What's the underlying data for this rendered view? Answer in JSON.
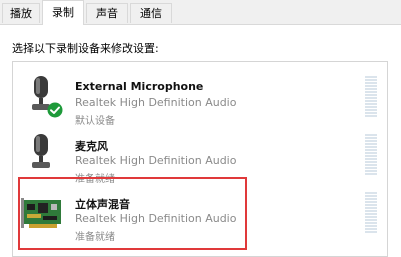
{
  "tabs": [
    {
      "label": "播放"
    },
    {
      "label": "录制"
    },
    {
      "label": "声音"
    },
    {
      "label": "通信"
    }
  ],
  "instruction": "选择以下录制设备来修改设置:",
  "devices": [
    {
      "name": "External Microphone",
      "driver": "Realtek High Definition Audio",
      "status": "默认设备"
    },
    {
      "name": "麦克风",
      "driver": "Realtek High Definition Audio",
      "status": "准备就绪"
    },
    {
      "name": "立体声混音",
      "driver": "Realtek High Definition Audio",
      "status": "准备就绪"
    }
  ],
  "colors": {
    "highlight": "#e0393a",
    "default_check": "#1e9a3a",
    "meter": "#dbe4ec"
  },
  "icons": {
    "microphone": "microphone-icon",
    "default": "check-badge-icon",
    "sound_card": "sound-card-icon"
  }
}
